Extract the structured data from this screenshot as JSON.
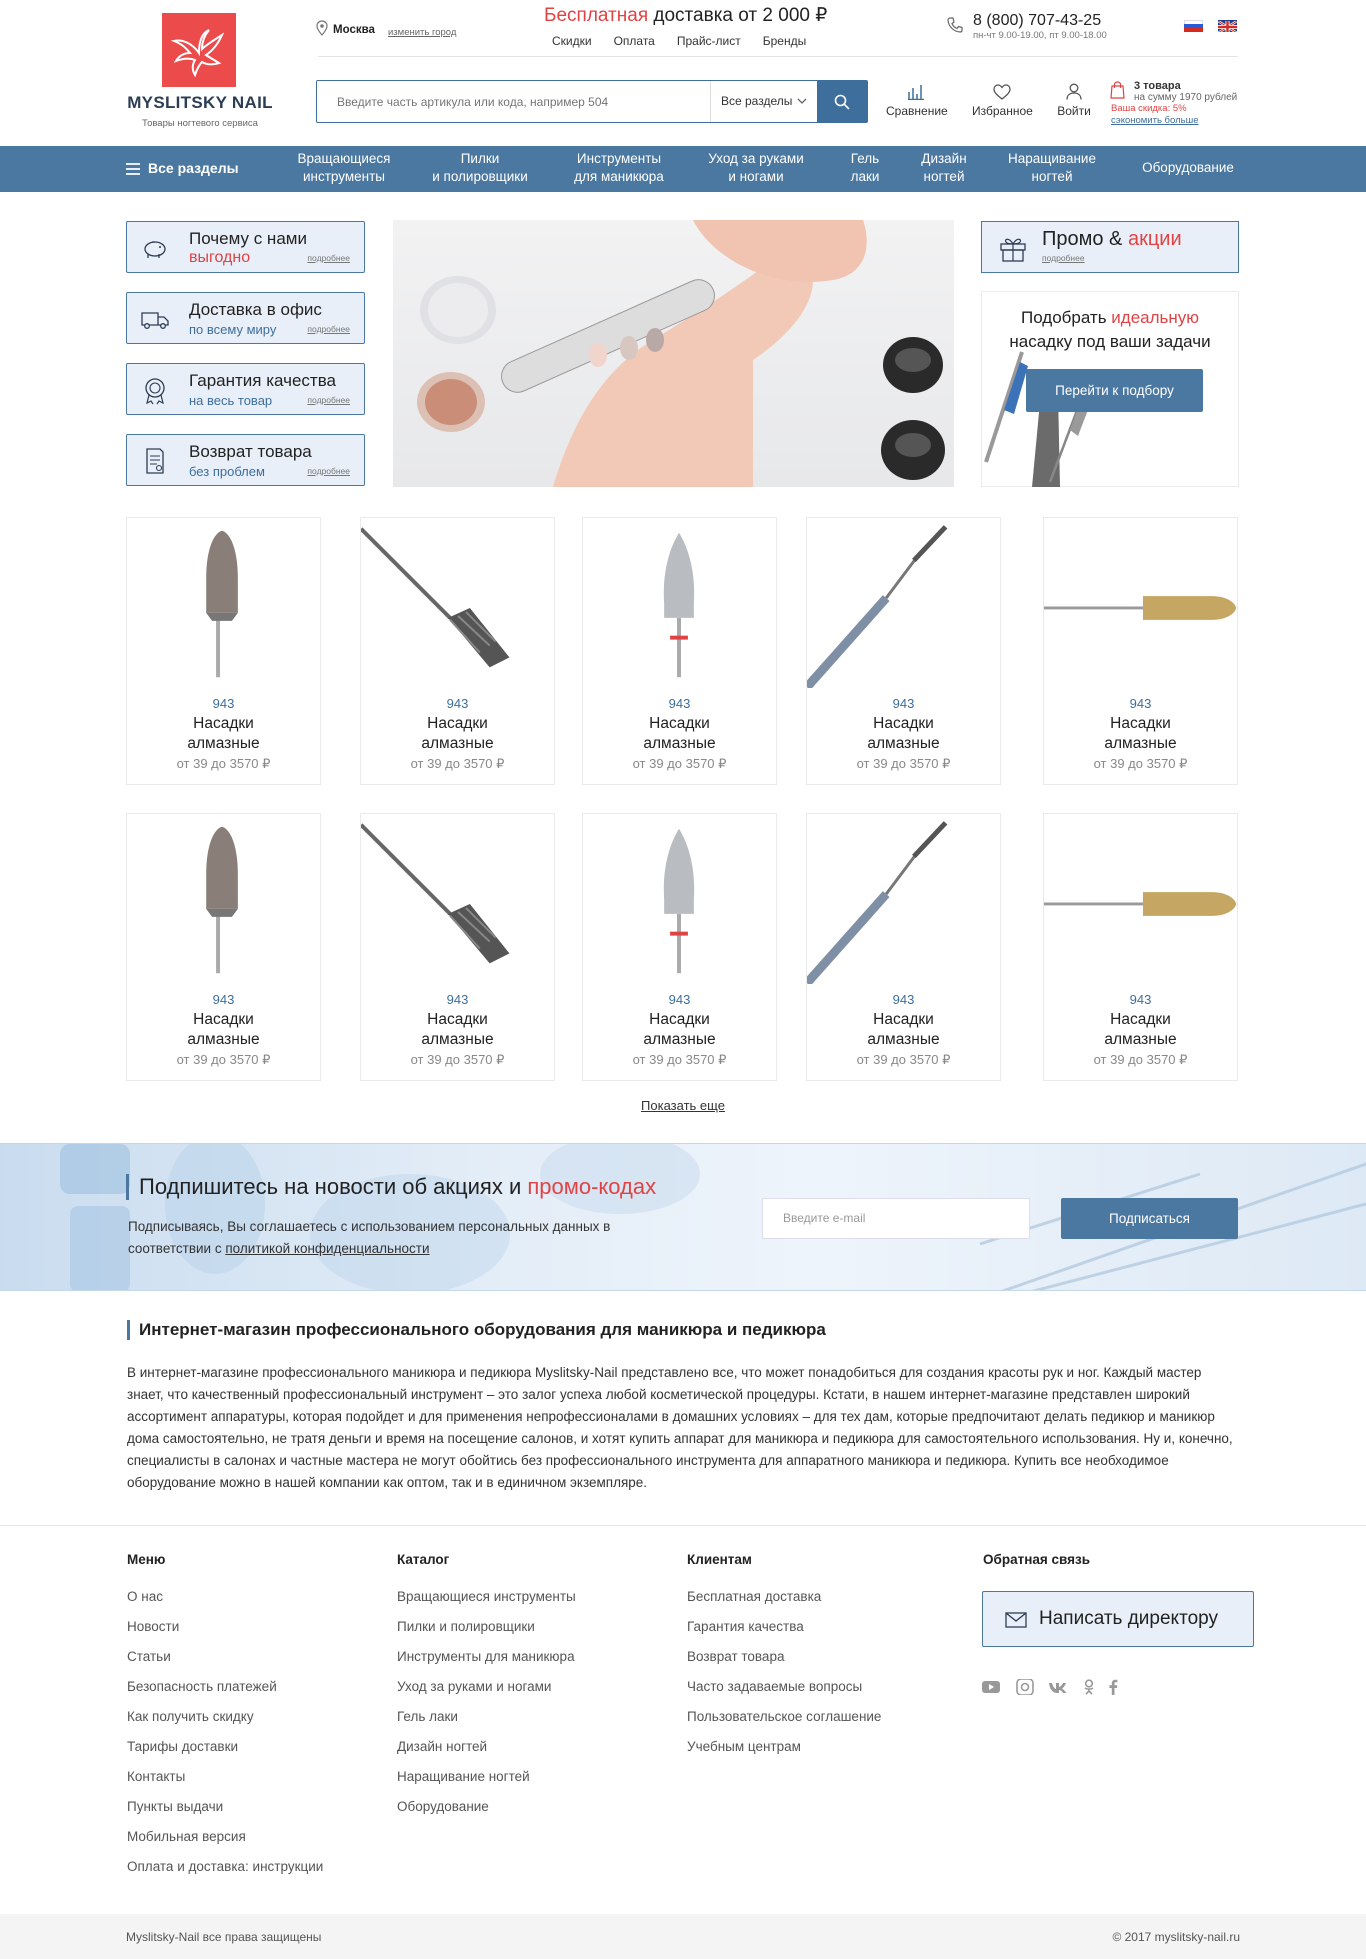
{
  "header": {
    "logo_name": "MYSLITSKY NAIL",
    "logo_sub": "Товары ногтевого сервиса",
    "city": "Москва",
    "city_change": "изменить город",
    "free_highlight": "Бесплатная",
    "free_rest": " доставка от 2 000 ₽",
    "top_links": [
      "Скидки",
      "Оплата",
      "Прайс-лист",
      "Бренды"
    ],
    "phone": "8 (800) 707-43-25",
    "hours": "пн-чт 9.00-19.00, пт 9.00-18.00",
    "search_placeholder": "Введите часть артикула или кода, например 504",
    "search_section": "Все разделы",
    "compare": "Сравнение",
    "favorites": "Избранное",
    "login": "Войти",
    "cart_count": "3 товара",
    "cart_sum": "на сумму 1970 рублей",
    "cart_discount": "Ваша скидка: 5%",
    "cart_save": "сэкономить больше"
  },
  "nav": {
    "all": "Все разделы",
    "items": [
      {
        "l1": "Вращающиеся",
        "l2": "инструменты"
      },
      {
        "l1": "Пилки",
        "l2": "и полировщики"
      },
      {
        "l1": "Инструменты",
        "l2": "для маникюра"
      },
      {
        "l1": "Уход за руками",
        "l2": "и ногами"
      },
      {
        "l1": "Гель",
        "l2": "лаки"
      },
      {
        "l1": "Дизайн",
        "l2": "ногтей"
      },
      {
        "l1": "Наращивание",
        "l2": "ногтей"
      },
      {
        "l1": "Оборудование",
        "l2": ""
      }
    ]
  },
  "benefits": [
    {
      "t1": "Почему с нами",
      "t2": "выгодно",
      "more": "подробнее",
      "icon": "piggy-bank-icon"
    },
    {
      "t1": "Доставка в офис",
      "t2": "по всему миру",
      "more": "подробнее",
      "icon": "truck-icon"
    },
    {
      "t1": "Гарантия качества",
      "t2": "на весь товар",
      "more": "подробнее",
      "icon": "quality-badge-icon"
    },
    {
      "t1": "Возврат товара",
      "t2": "без проблем",
      "more": "подробнее",
      "icon": "document-return-icon"
    }
  ],
  "promo": {
    "t1": "Промо & ",
    "t2": "акции",
    "more": "подробнее"
  },
  "picker": {
    "l1": "Подобрать ",
    "hl": "идеальную",
    "l2": "насадку под ваши задачи",
    "button": "Перейти к подбору"
  },
  "products": [
    {
      "code": "943",
      "name1": "Насадки",
      "name2": "алмазные",
      "price": "от 39 до 3570 ₽",
      "kind": "diamond-cone"
    },
    {
      "code": "943",
      "name1": "Насадки",
      "name2": "алмазные",
      "price": "от 39 до 3570 ₽",
      "kind": "carbide-diagonal"
    },
    {
      "code": "943",
      "name1": "Насадки",
      "name2": "алмазные",
      "price": "от 39 до 3570 ₽",
      "kind": "carbide-flame"
    },
    {
      "code": "943",
      "name1": "Насадки",
      "name2": "алмазные",
      "price": "от 39 до 3570 ₽",
      "kind": "thin-diagonal"
    },
    {
      "code": "943",
      "name1": "Насадки",
      "name2": "алмазные",
      "price": "от 39 до 3570 ₽",
      "kind": "silicone-horizontal"
    },
    {
      "code": "943",
      "name1": "Насадки",
      "name2": "алмазные",
      "price": "от 39 до 3570 ₽",
      "kind": "diamond-cone"
    },
    {
      "code": "943",
      "name1": "Насадки",
      "name2": "алмазные",
      "price": "от 39 до 3570 ₽",
      "kind": "carbide-diagonal"
    },
    {
      "code": "943",
      "name1": "Насадки",
      "name2": "алмазные",
      "price": "от 39 до 3570 ₽",
      "kind": "carbide-flame"
    },
    {
      "code": "943",
      "name1": "Насадки",
      "name2": "алмазные",
      "price": "от 39 до 3570 ₽",
      "kind": "thin-diagonal"
    },
    {
      "code": "943",
      "name1": "Насадки",
      "name2": "алмазные",
      "price": "от 39 до 3570 ₽",
      "kind": "silicone-horizontal"
    }
  ],
  "show_more": "Показать еще",
  "subscribe": {
    "title": "Подпишитесь на новости об акциях и ",
    "title_hl": "промо-кодах",
    "text1": "Подписываясь, Вы соглашаетесь с использованием персональных данных в",
    "text2": "соответствии с ",
    "policy": "политикой конфиденциальности",
    "email_placeholder": "Введите e-mail",
    "button": "Подписаться"
  },
  "seo": {
    "title": "Интернет-магазин профессионального оборудования для маникюра и педикюра",
    "text": "В интернет-магазине профессионального маникюра и педикюра Myslitsky-Nail представлено все, что может понадобиться для создания красоты рук и ног. Каждый мастер знает, что качественный профессиональный инструмент – это залог успеха любой косметической процедуры. Кстати, в нашем интернет-магазине представлен широкий ассортимент аппаратуры, которая подойдет и для применения непрофессионалами в домашних условиях – для тех дам, которые предпочитают делать педикюр и маникюр дома самостоятельно, не тратя деньги и время на посещение салонов, и хотят купить аппарат для маникюра и педикюра для самостоятельного использования. Ну и, конечно, специалисты в салонах и частные мастера не могут обойтись без профессионального инструмента для аппаратного маникюра и педикюра. Купить все необходимое оборудование можно в нашей компании как оптом, так и в единичном экземпляре."
  },
  "footer": {
    "menu_title": "Меню",
    "menu": [
      "О нас",
      "Новости",
      "Статьи",
      "Безопасность платежей",
      "Как получить скидку",
      "Тарифы доставки",
      "Контакты",
      "Пункты выдачи",
      "Мобильная версия",
      "Оплата и доставка: инструкции"
    ],
    "catalog_title": "Каталог",
    "catalog": [
      "Вращающиеся инструменты",
      "Пилки и полировщики",
      "Инструменты для маникюра",
      "Уход за руками и ногами",
      "Гель лаки",
      "Дизайн ногтей",
      "Наращивание ногтей",
      "Оборудование"
    ],
    "clients_title": "Клиентам",
    "clients": [
      "Бесплатная доставка",
      "Гарантия качества",
      "Возврат товара",
      "Часто задаваемые вопросы",
      "Пользовательское соглашение",
      "Учебным центрам"
    ],
    "feedback_title": "Обратная связь",
    "write_director": "Написать директору",
    "copyright_left": "Myslitsky-Nail все права защищены",
    "copyright_right": "© 2017 myslitsky-nail.ru"
  },
  "colors": {
    "accent": "#4b78a1",
    "red": "#e04343",
    "logo": "#ec4b4c"
  }
}
